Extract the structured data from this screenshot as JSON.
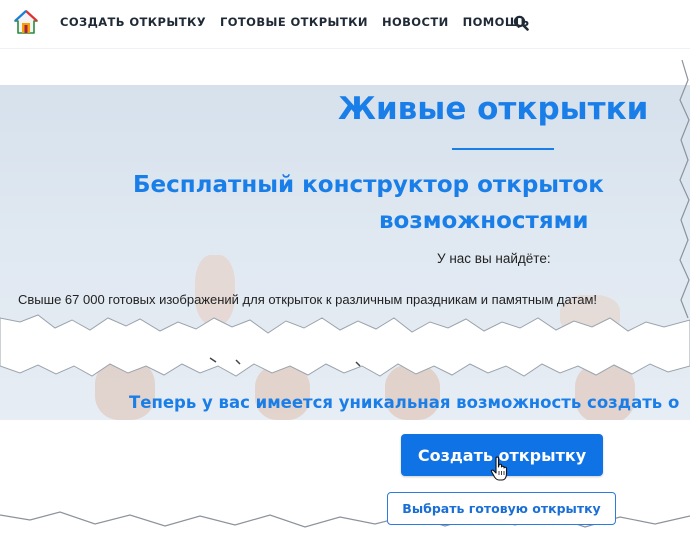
{
  "header": {
    "logo_icon": "house-icon",
    "nav": [
      {
        "label": "СОЗДАТЬ ОТКРЫТКУ"
      },
      {
        "label": "ГОТОВЫЕ ОТКРЫТКИ"
      },
      {
        "label": "НОВОСТИ"
      },
      {
        "label": "ПОМОЩЬ"
      }
    ],
    "search_icon": "search-icon"
  },
  "hero": {
    "title": "Живые открытки",
    "subtitle_line1": "Бесплатный конструктор открыток",
    "subtitle_line2": "возможностями",
    "find_text": "У нас вы найдёте:",
    "stock_text": "Свыше 67 000 готовых изображений для открыток к различным праздникам и памятным датам!",
    "opportunity_text": "Теперь у вас имеется уникальная возможность создать о"
  },
  "actions": {
    "create_label": "Создать открытку",
    "choose_label": "Выбрать готовую открытку"
  },
  "colors": {
    "accent": "#1a7ee8",
    "button": "#0f72e5",
    "nav_text": "#1f2a36"
  }
}
